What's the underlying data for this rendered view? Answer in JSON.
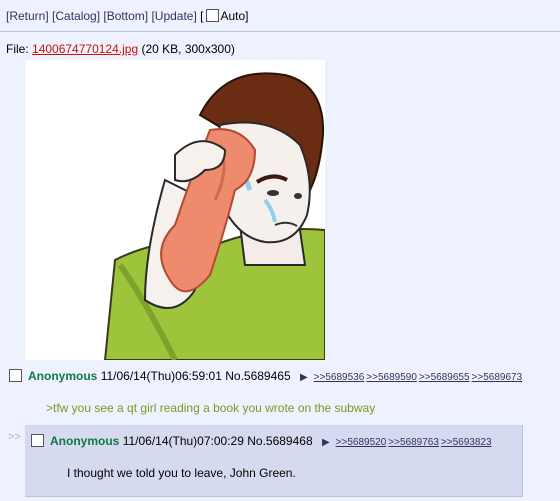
{
  "nav": {
    "return": "[Return]",
    "catalog": "[Catalog]",
    "bottom": "[Bottom]",
    "update": "[Update]",
    "auto_open": "[",
    "auto": "Auto]"
  },
  "file": {
    "prefix": "File: ",
    "name": "1400674770124.jpg",
    "meta": "(20 KB, 300x300)"
  },
  "op": {
    "name": "Anonymous",
    "datetime": "11/06/14(Thu)06:59:01",
    "number": "No.5689465",
    "backlinks": [
      ">>5689536",
      ">>5689590",
      ">>5689655",
      ">>5689673"
    ],
    "message": ">tfw you see a qt girl reading a book you wrote on the subway"
  },
  "reply": {
    "side": ">>",
    "name": "Anonymous",
    "datetime": "11/06/14(Thu)07:00:29",
    "number": "No.5689468",
    "backlinks": [
      ">>5689520",
      ">>5689763",
      ">>5693823"
    ],
    "message": "I thought we told you to leave, John Green."
  },
  "colors": {
    "background": "#eef2ff",
    "name": "#117743",
    "greentext": "#789922",
    "link": "#34345c",
    "filename": "#cc1105",
    "reply_bg": "#d6daf0"
  }
}
